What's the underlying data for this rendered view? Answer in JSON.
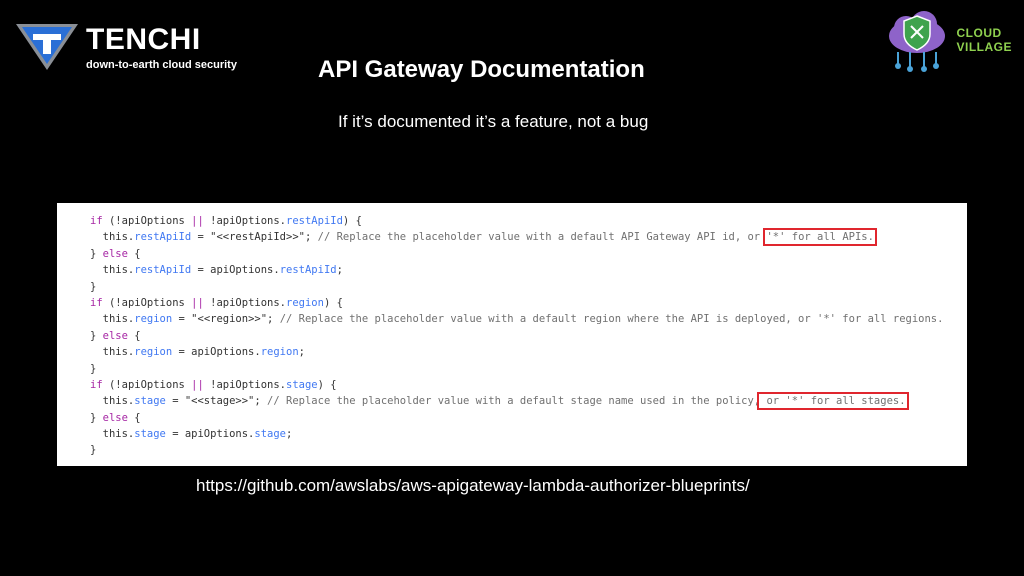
{
  "header": {
    "brand_name": "TENCHI",
    "brand_tagline": "down-to-earth cloud security",
    "partner_line1": "CLOUD",
    "partner_line2": "VILLAGE",
    "colors": {
      "tenchi_blue": "#2a6fd6",
      "village_green": "#8fd14f",
      "village_purple": "#8e63c9"
    },
    "icons": [
      "tenchi-logo-icon",
      "cloud-village-logo-icon"
    ]
  },
  "slide": {
    "title": "API Gateway Documentation",
    "subtitle": "If it’s documented it’s a feature, not a bug",
    "source_url": "https://github.com/awslabs/aws-apigateway-lambda-authorizer-blueprints/"
  },
  "code": {
    "highlight_color": "#e0262e",
    "lines": [
      [
        {
          "t": "if",
          "c": "kw"
        },
        {
          "t": " (!apiOptions "
        },
        {
          "t": "||",
          "c": "kw"
        },
        {
          "t": " !apiOptions."
        },
        {
          "t": "restApiId",
          "c": "prop"
        },
        {
          "t": ") {"
        }
      ],
      [
        {
          "t": "  this."
        },
        {
          "t": "restApiId",
          "c": "prop"
        },
        {
          "t": " = "
        },
        {
          "t": "\"<<restApiId>>\"",
          "c": "str"
        },
        {
          "t": "; "
        },
        {
          "t": "// Replace the placeholder value with a default API Gateway API id, or ",
          "c": "cm"
        },
        {
          "t": "'*' for all APIs.",
          "c": "cm",
          "hl": true
        }
      ],
      [
        {
          "t": "} "
        },
        {
          "t": "else",
          "c": "kw"
        },
        {
          "t": " {"
        }
      ],
      [
        {
          "t": "  this."
        },
        {
          "t": "restApiId",
          "c": "prop"
        },
        {
          "t": " = apiOptions."
        },
        {
          "t": "restApiId",
          "c": "prop"
        },
        {
          "t": ";"
        }
      ],
      [
        {
          "t": "}"
        }
      ],
      [
        {
          "t": "if",
          "c": "kw"
        },
        {
          "t": " (!apiOptions "
        },
        {
          "t": "||",
          "c": "kw"
        },
        {
          "t": " !apiOptions."
        },
        {
          "t": "region",
          "c": "prop"
        },
        {
          "t": ") {"
        }
      ],
      [
        {
          "t": "  this."
        },
        {
          "t": "region",
          "c": "prop"
        },
        {
          "t": " = "
        },
        {
          "t": "\"<<region>>\"",
          "c": "str"
        },
        {
          "t": "; "
        },
        {
          "t": "// Replace the placeholder value with a default region where the API is deployed, or '*' for all regions.",
          "c": "cm"
        }
      ],
      [
        {
          "t": "} "
        },
        {
          "t": "else",
          "c": "kw"
        },
        {
          "t": " {"
        }
      ],
      [
        {
          "t": "  this."
        },
        {
          "t": "region",
          "c": "prop"
        },
        {
          "t": " = apiOptions."
        },
        {
          "t": "region",
          "c": "prop"
        },
        {
          "t": ";"
        }
      ],
      [
        {
          "t": "}"
        }
      ],
      [
        {
          "t": "if",
          "c": "kw"
        },
        {
          "t": " (!apiOptions "
        },
        {
          "t": "||",
          "c": "kw"
        },
        {
          "t": " !apiOptions."
        },
        {
          "t": "stage",
          "c": "prop"
        },
        {
          "t": ") {"
        }
      ],
      [
        {
          "t": "  this."
        },
        {
          "t": "stage",
          "c": "prop"
        },
        {
          "t": " = "
        },
        {
          "t": "\"<<stage>>\"",
          "c": "str"
        },
        {
          "t": "; "
        },
        {
          "t": "// Replace the placeholder value with a default stage name used in the policy,",
          "c": "cm"
        },
        {
          "t": " or '*' for all stages.",
          "c": "cm",
          "hl": true
        }
      ],
      [
        {
          "t": "} "
        },
        {
          "t": "else",
          "c": "kw"
        },
        {
          "t": " {"
        }
      ],
      [
        {
          "t": "  this."
        },
        {
          "t": "stage",
          "c": "prop"
        },
        {
          "t": " = apiOptions."
        },
        {
          "t": "stage",
          "c": "prop"
        },
        {
          "t": ";"
        }
      ],
      [
        {
          "t": "}"
        }
      ]
    ]
  }
}
